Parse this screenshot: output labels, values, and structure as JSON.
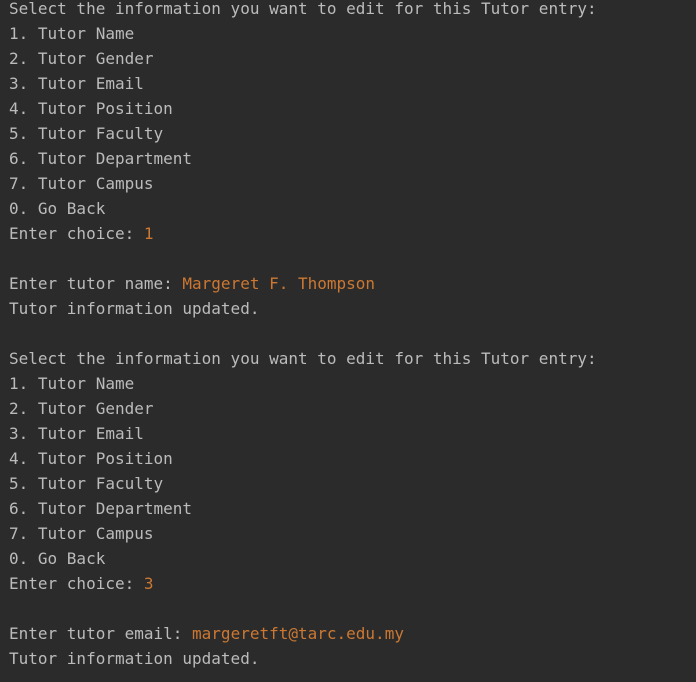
{
  "console": {
    "block1": {
      "prompt": "Select the information you want to edit for this Tutor entry:",
      "options": [
        "1. Tutor Name",
        "2. Tutor Gender",
        "3. Tutor Email",
        "4. Tutor Position",
        "5. Tutor Faculty",
        "6. Tutor Department",
        "7. Tutor Campus",
        "0. Go Back"
      ],
      "choice_label": "Enter choice: ",
      "choice_value": "1",
      "field_label": "Enter tutor name: ",
      "field_value": "Margeret F. Thompson",
      "result": "Tutor information updated."
    },
    "block2": {
      "prompt": "Select the information you want to edit for this Tutor entry:",
      "options": [
        "1. Tutor Name",
        "2. Tutor Gender",
        "3. Tutor Email",
        "4. Tutor Position",
        "5. Tutor Faculty",
        "6. Tutor Department",
        "7. Tutor Campus",
        "0. Go Back"
      ],
      "choice_label": "Enter choice: ",
      "choice_value": "3",
      "field_label": "Enter tutor email: ",
      "field_value": "margeretft@tarc.edu.my",
      "result": "Tutor information updated."
    },
    "colors": {
      "background": "#2b2b2b",
      "text": "#bbbbbb",
      "user_input": "#cc7832"
    }
  }
}
